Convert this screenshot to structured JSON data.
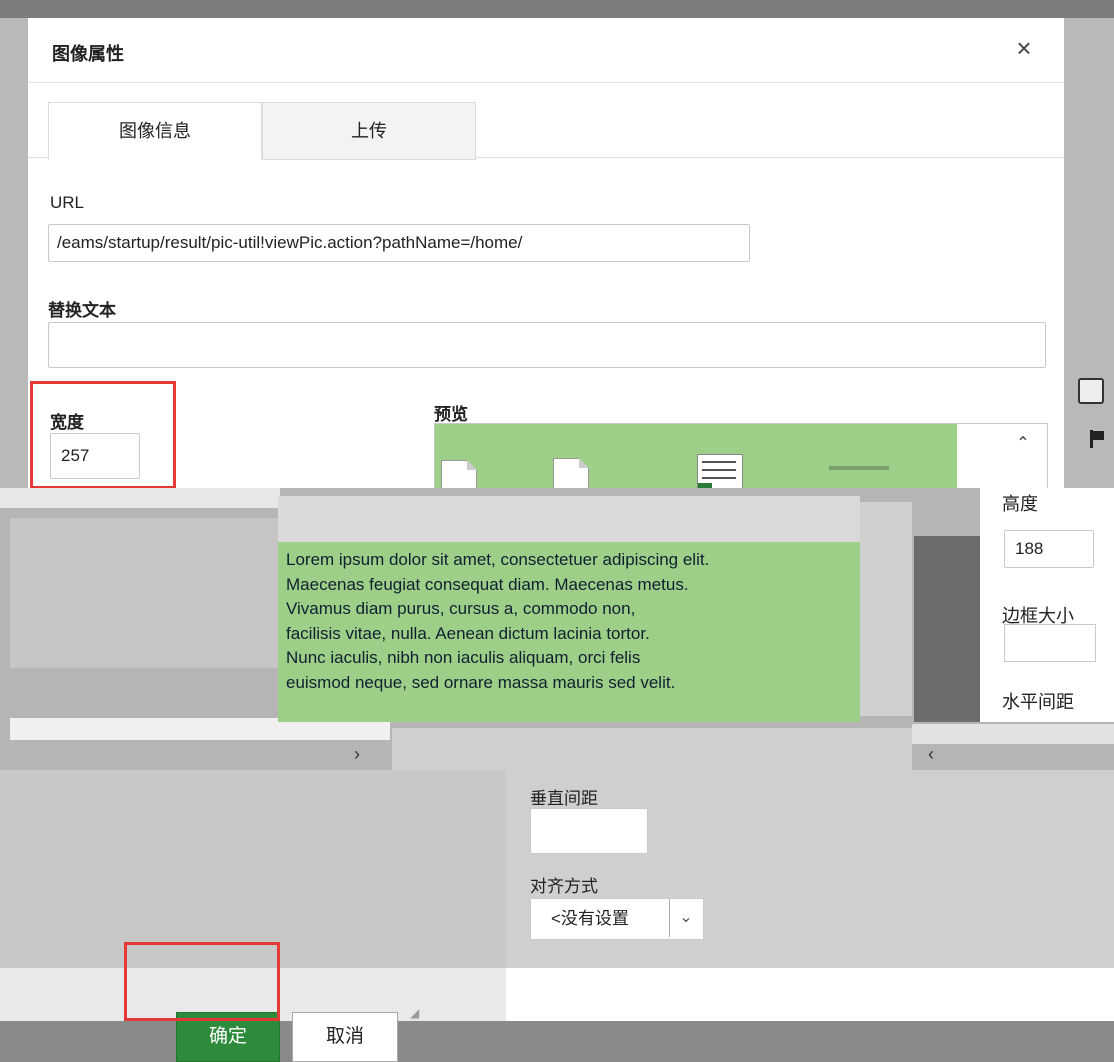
{
  "dialog": {
    "title": "图像属性",
    "close_label": "×",
    "tabs": [
      {
        "label": "图像信息",
        "active": true
      },
      {
        "label": "上传",
        "active": false
      }
    ],
    "url_label": "URL",
    "url_value": "/eams/startup/result/pic-util!viewPic.action?pathName=/home/",
    "alt_label": "替换文本",
    "alt_value": "",
    "width_label": "宽度",
    "width_value": "257",
    "preview_label": "预览"
  },
  "preview_text": {
    "line1": "Lorem ipsum dolor sit amet, consectetuer adipiscing elit.",
    "line2": "Maecenas feugiat consequat diam. Maecenas metus.",
    "line3": "Vivamus diam purus, cursus a, commodo non,",
    "line4": "facilisis vitae, nulla. Aenean dictum lacinia tortor.",
    "line5": "Nunc iaculis, nibh non iaculis aliquam, orci felis",
    "line6": "euismod neque, sed ornare massa mauris sed velit."
  },
  "right_fields": {
    "height_label": "高度",
    "height_value": "188",
    "border_label": "边框大小",
    "hspace_label": "水平间距"
  },
  "lower_fields": {
    "vspace_label": "垂直间距",
    "align_label": "对齐方式",
    "align_value": "<没有设置"
  },
  "footer": {
    "ok_label": "确定",
    "cancel_label": "取消"
  },
  "colors": {
    "highlight": "#e53935",
    "ok_button": "#2e8b3c",
    "preview_background": "#9dcf88"
  }
}
